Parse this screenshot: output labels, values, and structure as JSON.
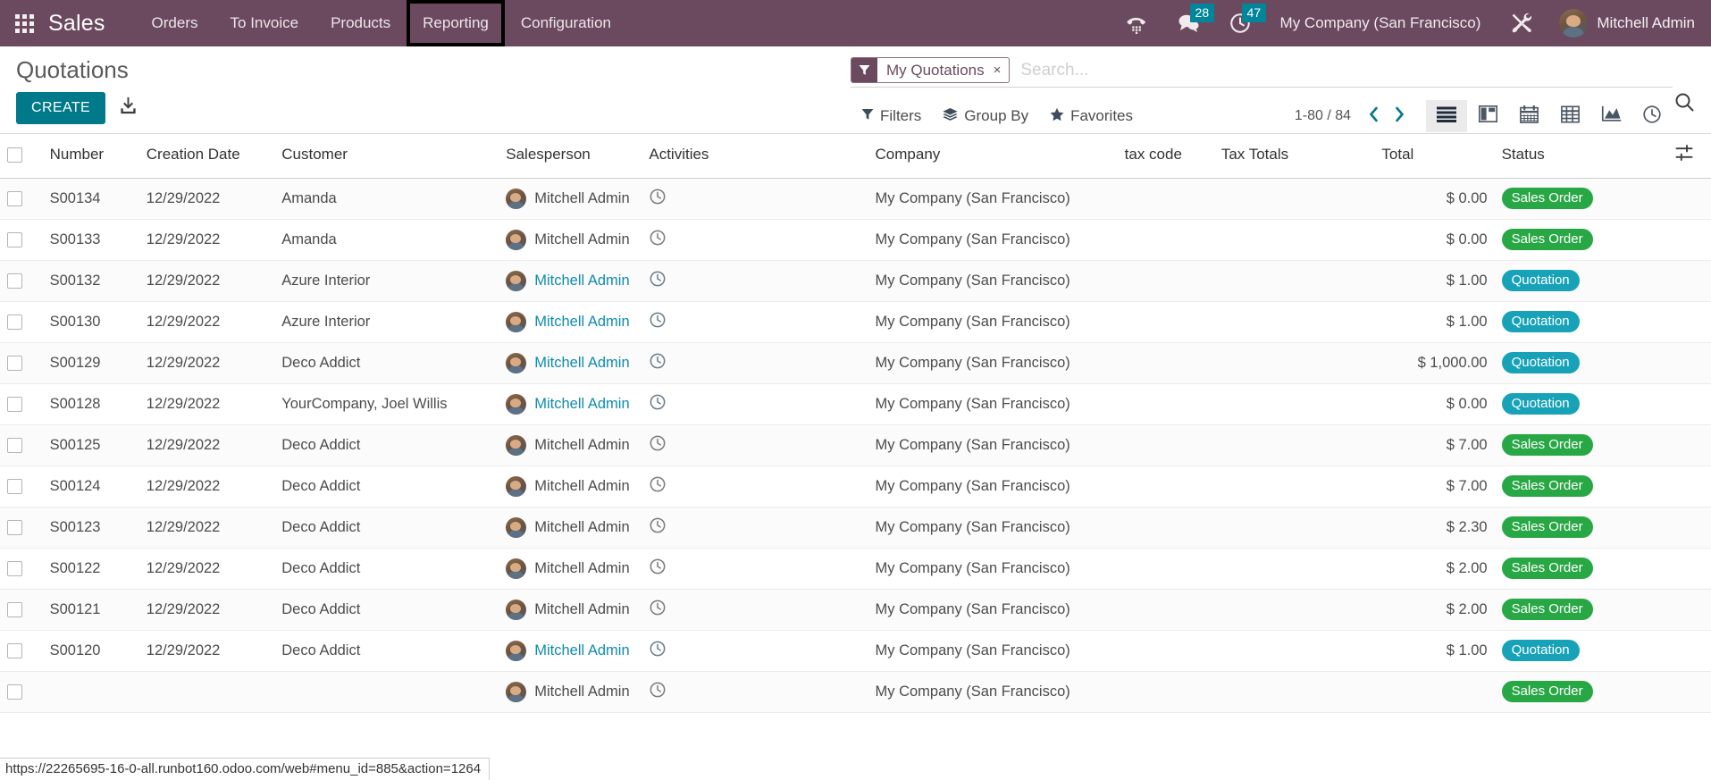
{
  "navbar": {
    "apps_icon": "apps-grid-icon",
    "brand": "Sales",
    "menu_items": [
      {
        "label": "Orders",
        "highlighted": false
      },
      {
        "label": "To Invoice",
        "highlighted": false
      },
      {
        "label": "Products",
        "highlighted": false
      },
      {
        "label": "Reporting",
        "highlighted": true
      },
      {
        "label": "Configuration",
        "highlighted": false
      }
    ],
    "phone_icon": "phone-dialpad-icon",
    "messages": {
      "icon": "chat-bubble-icon",
      "count": "28"
    },
    "activities": {
      "icon": "clock-icon",
      "count": "47"
    },
    "company": "My Company (San Francisco)",
    "debug_icon": "tools-wrench-hammer-icon",
    "user": {
      "name": "Mitchell Admin",
      "avatar": "user-avatar"
    },
    "badge_color": "#00859b",
    "bg_color": "#6b4a5f"
  },
  "control_panel": {
    "title": "Quotations",
    "create_label": "CREATE",
    "create_color": "#00798a",
    "import_icon": "import-download-icon",
    "search": {
      "facet": {
        "icon": "filter-funnel-icon",
        "label": "My Quotations",
        "remove": "×"
      },
      "placeholder": "Search...",
      "value": "",
      "magnifier_icon": "search-icon"
    },
    "dropdowns": [
      {
        "label": "Filters",
        "icon": "filter-funnel-icon"
      },
      {
        "label": "Group By",
        "icon": "layers-icon"
      },
      {
        "label": "Favorites",
        "icon": "star-icon"
      }
    ],
    "pager": {
      "value": "1-80 / 84",
      "prev": "‹",
      "next": "›"
    },
    "views": [
      {
        "name": "list",
        "icon": "list-view-icon",
        "active": true
      },
      {
        "name": "kanban",
        "icon": "kanban-view-icon",
        "active": false
      },
      {
        "name": "calendar",
        "icon": "calendar-view-icon",
        "active": false
      },
      {
        "name": "pivot",
        "icon": "pivot-view-icon",
        "active": false
      },
      {
        "name": "graph",
        "icon": "graph-view-icon",
        "active": false
      },
      {
        "name": "activity",
        "icon": "activity-view-icon",
        "active": false
      }
    ]
  },
  "table": {
    "columns": [
      "Number",
      "Creation Date",
      "Customer",
      "Salesperson",
      "Activities",
      "Company",
      "tax code",
      "Tax Totals",
      "Total",
      "Status"
    ],
    "optional_columns_icon": "sliders-icon",
    "select_all_checkbox": false,
    "rows": [
      {
        "number": "S00134",
        "date": "12/29/2022",
        "customer": "Amanda",
        "salesperson": "Mitchell Admin",
        "activities": "",
        "company": "My Company (San Francisco)",
        "tax_code": "",
        "tax_totals": "",
        "total": "$ 0.00",
        "status": "Sales Order",
        "status_type": "success",
        "link": false
      },
      {
        "number": "S00133",
        "date": "12/29/2022",
        "customer": "Amanda",
        "salesperson": "Mitchell Admin",
        "activities": "",
        "company": "My Company (San Francisco)",
        "tax_code": "",
        "tax_totals": "",
        "total": "$ 0.00",
        "status": "Sales Order",
        "status_type": "success",
        "link": false
      },
      {
        "number": "S00132",
        "date": "12/29/2022",
        "customer": "Azure Interior",
        "salesperson": "Mitchell Admin",
        "activities": "",
        "company": "My Company (San Francisco)",
        "tax_code": "",
        "tax_totals": "",
        "total": "$ 1.00",
        "status": "Quotation",
        "status_type": "info",
        "link": true
      },
      {
        "number": "S00130",
        "date": "12/29/2022",
        "customer": "Azure Interior",
        "salesperson": "Mitchell Admin",
        "activities": "",
        "company": "My Company (San Francisco)",
        "tax_code": "",
        "tax_totals": "",
        "total": "$ 1.00",
        "status": "Quotation",
        "status_type": "info",
        "link": true
      },
      {
        "number": "S00129",
        "date": "12/29/2022",
        "customer": "Deco Addict",
        "salesperson": "Mitchell Admin",
        "activities": "",
        "company": "My Company (San Francisco)",
        "tax_code": "",
        "tax_totals": "",
        "total": "$ 1,000.00",
        "status": "Quotation",
        "status_type": "info",
        "link": true
      },
      {
        "number": "S00128",
        "date": "12/29/2022",
        "customer": "YourCompany, Joel Willis",
        "salesperson": "Mitchell Admin",
        "activities": "",
        "company": "My Company (San Francisco)",
        "tax_code": "",
        "tax_totals": "",
        "total": "$ 0.00",
        "status": "Quotation",
        "status_type": "info",
        "link": true
      },
      {
        "number": "S00125",
        "date": "12/29/2022",
        "customer": "Deco Addict",
        "salesperson": "Mitchell Admin",
        "activities": "",
        "company": "My Company (San Francisco)",
        "tax_code": "",
        "tax_totals": "",
        "total": "$ 7.00",
        "status": "Sales Order",
        "status_type": "success",
        "link": false
      },
      {
        "number": "S00124",
        "date": "12/29/2022",
        "customer": "Deco Addict",
        "salesperson": "Mitchell Admin",
        "activities": "",
        "company": "My Company (San Francisco)",
        "tax_code": "",
        "tax_totals": "",
        "total": "$ 7.00",
        "status": "Sales Order",
        "status_type": "success",
        "link": false
      },
      {
        "number": "S00123",
        "date": "12/29/2022",
        "customer": "Deco Addict",
        "salesperson": "Mitchell Admin",
        "activities": "",
        "company": "My Company (San Francisco)",
        "tax_code": "",
        "tax_totals": "",
        "total": "$ 2.30",
        "status": "Sales Order",
        "status_type": "success",
        "link": false
      },
      {
        "number": "S00122",
        "date": "12/29/2022",
        "customer": "Deco Addict",
        "salesperson": "Mitchell Admin",
        "activities": "",
        "company": "My Company (San Francisco)",
        "tax_code": "",
        "tax_totals": "",
        "total": "$ 2.00",
        "status": "Sales Order",
        "status_type": "success",
        "link": false
      },
      {
        "number": "S00121",
        "date": "12/29/2022",
        "customer": "Deco Addict",
        "salesperson": "Mitchell Admin",
        "activities": "",
        "company": "My Company (San Francisco)",
        "tax_code": "",
        "tax_totals": "",
        "total": "$ 2.00",
        "status": "Sales Order",
        "status_type": "success",
        "link": false
      },
      {
        "number": "S00120",
        "date": "12/29/2022",
        "customer": "Deco Addict",
        "salesperson": "Mitchell Admin",
        "activities": "",
        "company": "My Company (San Francisco)",
        "tax_code": "",
        "tax_totals": "",
        "total": "$ 1.00",
        "status": "Quotation",
        "status_type": "info",
        "link": true
      },
      {
        "number": "",
        "date": "",
        "customer": "",
        "salesperson": "Mitchell Admin",
        "activities": "",
        "company": "My Company (San Francisco)",
        "tax_code": "",
        "tax_totals": "",
        "total": "",
        "status": "Sales Order",
        "status_type": "success",
        "link": false
      }
    ]
  },
  "statusbar": {
    "url": "https://22265695-16-0-all.runbot160.odoo.com/web#menu_id=885&action=1264"
  }
}
